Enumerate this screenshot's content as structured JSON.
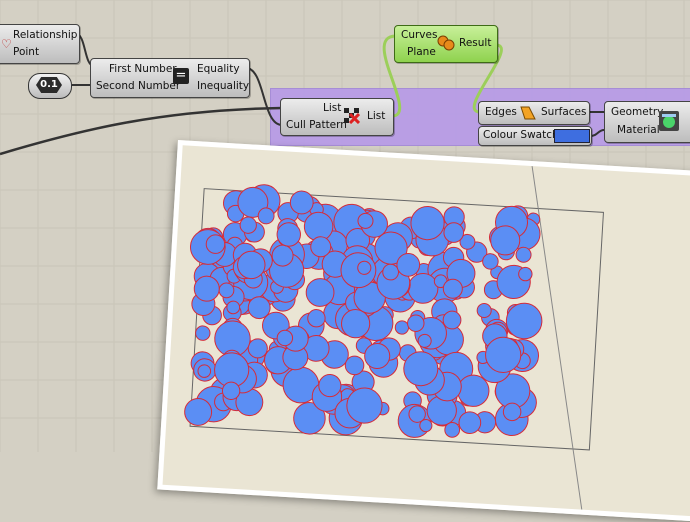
{
  "canvas": {
    "background": "#d4d0c4",
    "group_color": "#b89ce6",
    "circle_fill": "#5b8ef4",
    "circle_stroke": "#d42c3a"
  },
  "components": {
    "relationship": {
      "inputs": [
        "Relationship",
        "Point"
      ]
    },
    "number_slider": {
      "value": "0.1"
    },
    "equality": {
      "inputs": [
        "First Number",
        "Second Number"
      ],
      "outputs": [
        "Equality",
        "Inequality"
      ]
    },
    "cull_pattern": {
      "inputs": [
        "List",
        "Cull Pattern"
      ],
      "output": "List"
    },
    "boundary": {
      "inputs": [
        "Curves",
        "Plane"
      ],
      "output": "Result"
    },
    "brep_edges": {
      "input": "Edges",
      "output": "Surfaces"
    },
    "colour_swatch": {
      "label": "Colour Swatch",
      "color": "#3e6ee0"
    },
    "preview": {
      "inputs": [
        "Geometry",
        "Material"
      ]
    }
  }
}
